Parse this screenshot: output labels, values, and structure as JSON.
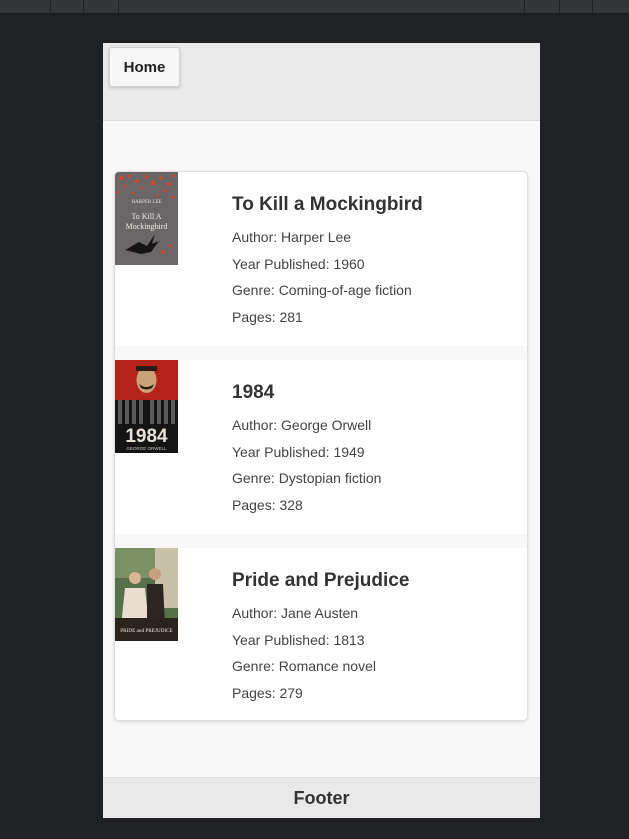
{
  "header": {
    "home_label": "Home"
  },
  "books": [
    {
      "title": "To Kill a Mockingbird",
      "author": "Author: Harper Lee",
      "year": "Year Published: 1960",
      "genre": "Genre: Coming-of-age fiction",
      "pages": "Pages: 281",
      "cover_text": {
        "author": "HARPER LEE",
        "title_line1": "To Kill A",
        "title_line2": "Mockingbird"
      }
    },
    {
      "title": "1984",
      "author": "Author: George Orwell",
      "year": "Year Published: 1949",
      "genre": "Genre: Dystopian fiction",
      "pages": "Pages: 328",
      "cover_text": {
        "title": "1984",
        "author": "GEORGE ORWELL"
      }
    },
    {
      "title": "Pride and Prejudice",
      "author": "Author: Jane Austen",
      "year": "Year Published: 1813",
      "genre": "Genre: Romance novel",
      "pages": "Pages: 279",
      "cover_text": {
        "title": "PRIDE and PREJUDICE"
      }
    }
  ],
  "footer": {
    "label": "Footer"
  },
  "colors": {
    "page_bg": "#202124",
    "content_bg": "#f8f8f8",
    "bar_bg": "#e9e9e9",
    "card_bg": "#ffffff",
    "text": "#333333"
  }
}
